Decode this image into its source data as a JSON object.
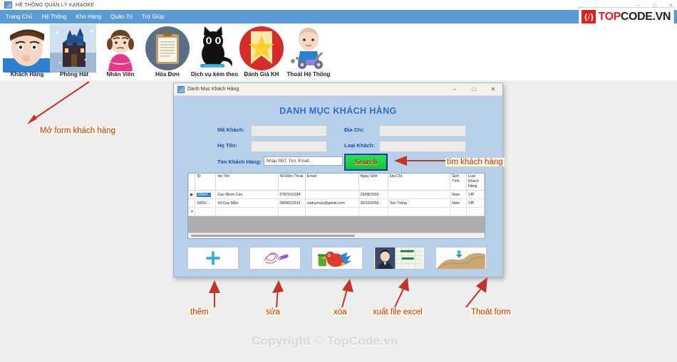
{
  "window": {
    "title": "HỆ THỐNG QUẢN LÝ KARAOKE",
    "icon": "app-icon",
    "minimize": "–",
    "maximize": "□",
    "close": "×"
  },
  "menu": {
    "items": [
      {
        "label": "Trang Chủ"
      },
      {
        "label": "Hệ Thống"
      },
      {
        "label": "Kho Hàng"
      },
      {
        "label": "Quản Trị"
      },
      {
        "label": "Trợ Giúp"
      }
    ]
  },
  "logo": {
    "badge": "{/}",
    "top": "TOP",
    "code": "CODE.VN"
  },
  "toolbar": {
    "items": [
      {
        "label": "Khách Hàng",
        "icon": "customer-face-icon"
      },
      {
        "label": "Phòng Hát",
        "icon": "castle-room-icon"
      },
      {
        "label": "Nhân Viên",
        "icon": "employee-woman-icon"
      },
      {
        "label": "Hóa Đơn",
        "icon": "invoice-clipboard-icon"
      },
      {
        "label": "Dịch vụ kèm theo",
        "icon": "black-cat-icon"
      },
      {
        "label": "Đánh Giá KH",
        "icon": "star-badge-icon"
      },
      {
        "label": "Thoát Hệ Thống",
        "icon": "baby-scooter-icon"
      }
    ]
  },
  "dialog": {
    "titlebar": {
      "title": "Danh Mục Khách Hàng",
      "icon": "form-icon",
      "minimize": "–",
      "maximize": "□",
      "close": "✕"
    },
    "heading": "DANH MỤC KHÁCH HÀNG",
    "fields": {
      "ma_khach_label": "Mã Khách:",
      "ma_khach_value": "",
      "ho_ten_label": "Họ Tên:",
      "ho_ten_value": "",
      "dia_chi_label": "Địa Chỉ:",
      "dia_chi_value": "",
      "loai_khach_label": "Loại Khách:",
      "loai_khach_value": "",
      "tim_khach_label": "Tìm Khách Hàng:",
      "tim_khach_placeholder": "Nhập SĐT, Tên, Email..",
      "search_button": "Search"
    },
    "grid": {
      "columns": [
        "",
        "ID",
        "Họ Tên",
        "Số Điện Thoại",
        "Email",
        "Ngày Sinh",
        "Địa Chỉ",
        "Giới Tính",
        "Loại Khách Hàng"
      ],
      "rows": [
        {
          "marker": "▶",
          "id": "ENA4...",
          "ho_ten": "Cao Nhơn Cao",
          "sdt": "0787910184",
          "email": "",
          "ngay_sinh": "29/08/2003",
          "dia_chi": "",
          "gioi_tinh": "Nam",
          "loai_khach": "VIP",
          "selected": true
        },
        {
          "marker": "",
          "id": "S9DV...",
          "ho_ten": "Võ Duy Mẫn",
          "sdt": "0899022913",
          "email": "voduyman@gmail.com",
          "ngay_sinh": "30/10/2003",
          "dia_chi": "Sóc Trăng",
          "gioi_tinh": "Nam",
          "loai_khach": "VIP",
          "selected": false
        },
        {
          "marker": "✳",
          "id": "",
          "ho_ten": "",
          "sdt": "",
          "email": "",
          "ngay_sinh": "",
          "dia_chi": "",
          "gioi_tinh": "",
          "loai_khach": "",
          "selected": false
        }
      ]
    },
    "action_buttons": [
      {
        "icon": "plus-add-icon",
        "name": "add-button"
      },
      {
        "icon": "pencil-edit-icon",
        "name": "edit-button"
      },
      {
        "icon": "parrot-delete-icon",
        "name": "delete-button"
      },
      {
        "icon": "excel-export-icon",
        "name": "export-excel-button"
      },
      {
        "icon": "exit-desert-icon",
        "name": "exit-form-button"
      }
    ]
  },
  "annotations": {
    "open_form": "Mở form khách hàng",
    "search_customer": "tìm khách hàng",
    "add": "thêm",
    "edit": "sửa",
    "delete": "xóa",
    "export": "xuất file excel",
    "exit": "Thoát form"
  },
  "watermark": "Copyright © TopCode.vn",
  "colors": {
    "menu_blue": "#5b9bd5",
    "dialog_blue": "#b9d0ea",
    "heading_blue": "#2e6fc4",
    "label_blue": "#1a4f9c",
    "annotation_red": "#c0342b",
    "logo_red": "#e02020",
    "selected_blue": "#2b7dd4"
  }
}
